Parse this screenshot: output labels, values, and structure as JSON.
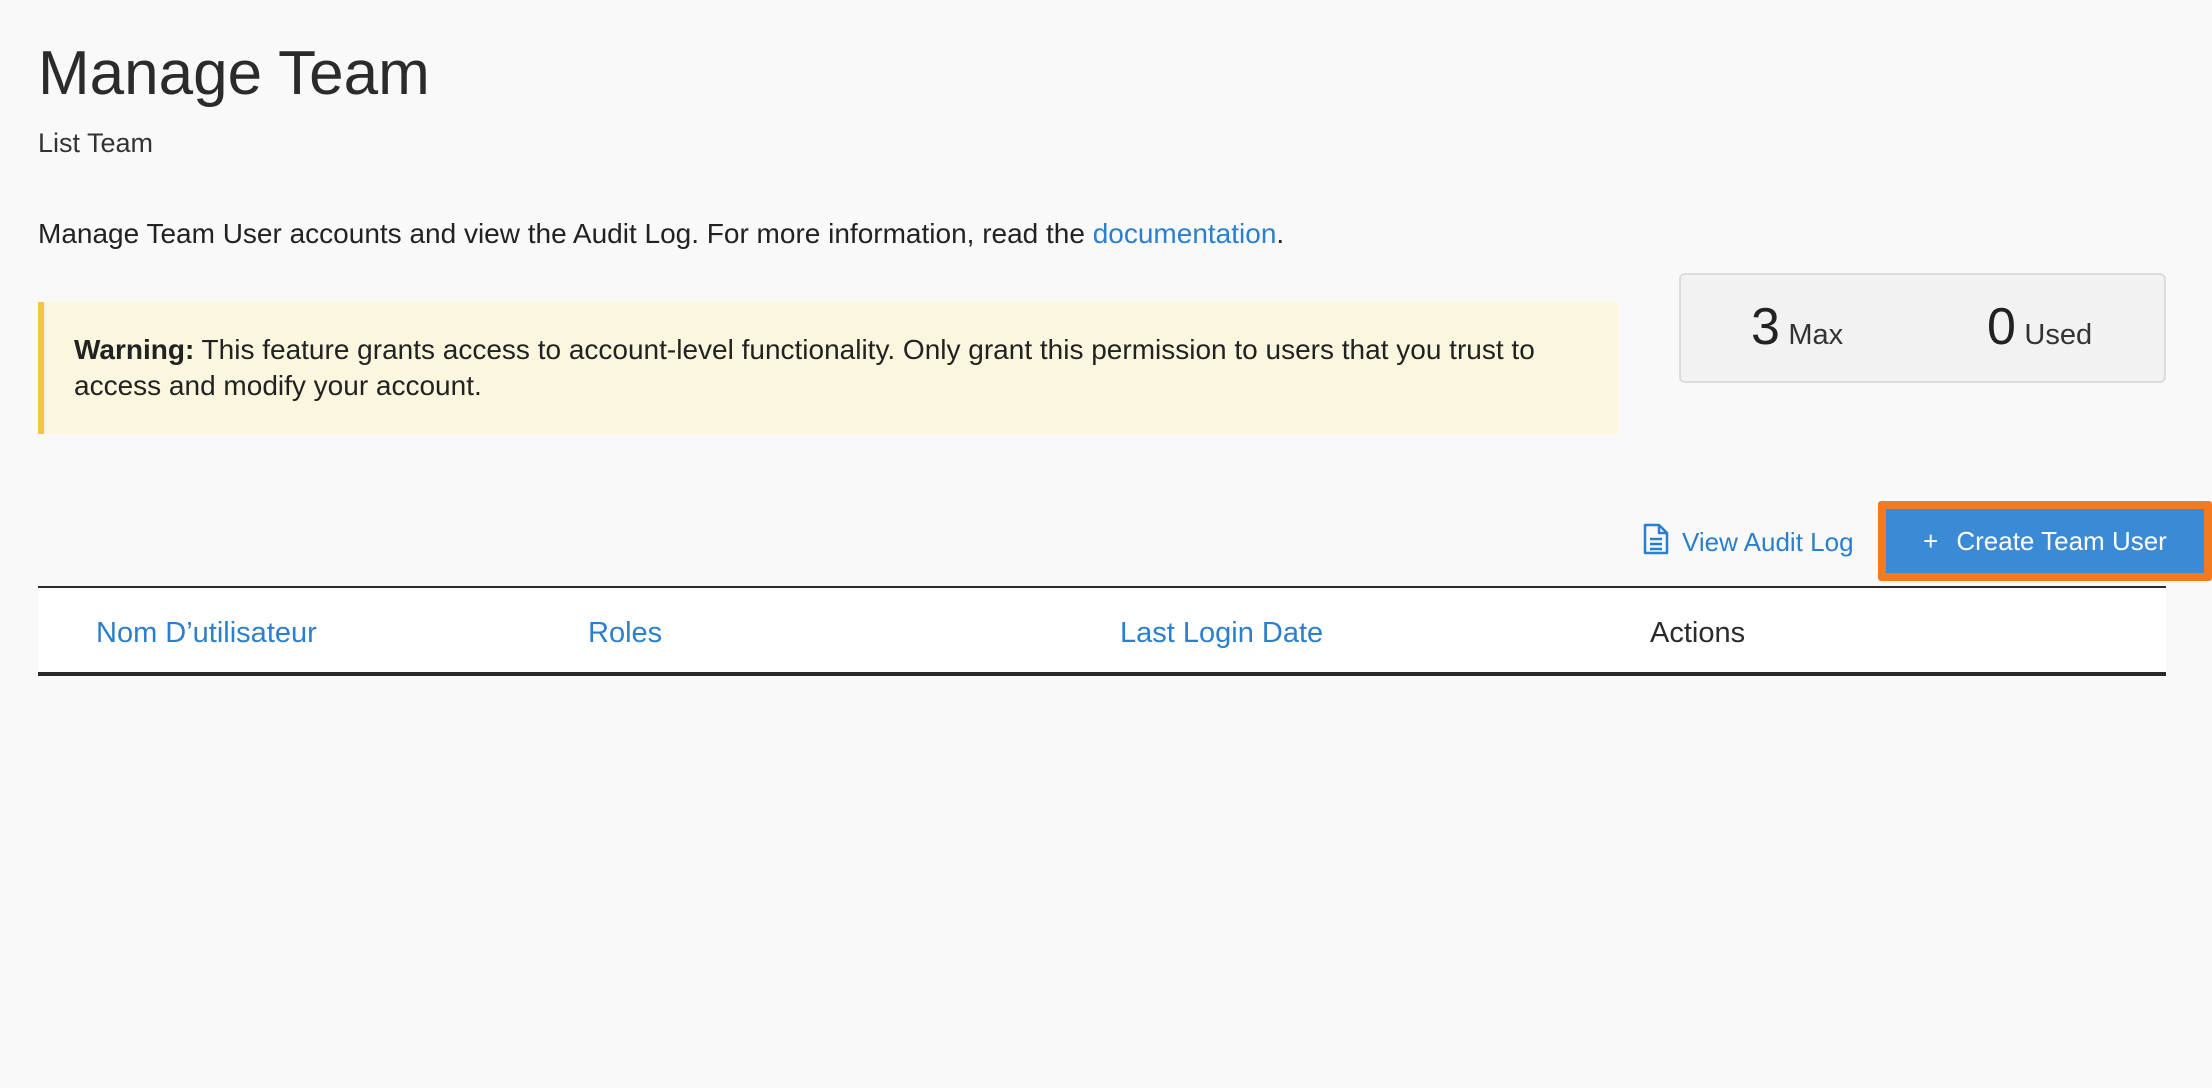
{
  "header": {
    "title": "Manage Team",
    "subtitle": "List Team"
  },
  "intro": {
    "text_before": "Manage Team User accounts and view the Audit Log. For more information, read the ",
    "link_text": "documentation",
    "text_after": "."
  },
  "warning": {
    "label": "Warning:",
    "text": " This feature grants access to account-level functionality. Only grant this permission to users that you trust to access and modify your account."
  },
  "quota": {
    "max_value": "3",
    "max_label": "Max",
    "used_value": "0",
    "used_label": "Used"
  },
  "toolbar": {
    "audit_log_label": "View Audit Log",
    "audit_log_icon": "document-icon",
    "create_label": "Create Team User",
    "create_icon": "+"
  },
  "table": {
    "columns": [
      {
        "label": "Nom D’utilisateur",
        "sortable": true
      },
      {
        "label": "Roles",
        "sortable": true
      },
      {
        "label": "Last Login Date",
        "sortable": true
      },
      {
        "label": "Actions",
        "sortable": false
      }
    ],
    "rows": []
  },
  "colors": {
    "link": "#2a7fcf",
    "button": "#3a8ad6",
    "highlight": "#f47a20",
    "warning_bg": "#faf7de",
    "warning_border": "#f5c542"
  }
}
